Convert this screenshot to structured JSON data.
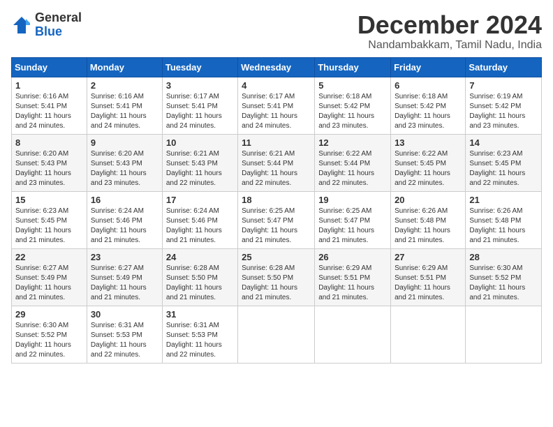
{
  "logo": {
    "general": "General",
    "blue": "Blue"
  },
  "title": "December 2024",
  "location": "Nandambakkam, Tamil Nadu, India",
  "headers": [
    "Sunday",
    "Monday",
    "Tuesday",
    "Wednesday",
    "Thursday",
    "Friday",
    "Saturday"
  ],
  "weeks": [
    [
      {
        "day": "1",
        "info": "Sunrise: 6:16 AM\nSunset: 5:41 PM\nDaylight: 11 hours\nand 24 minutes."
      },
      {
        "day": "2",
        "info": "Sunrise: 6:16 AM\nSunset: 5:41 PM\nDaylight: 11 hours\nand 24 minutes."
      },
      {
        "day": "3",
        "info": "Sunrise: 6:17 AM\nSunset: 5:41 PM\nDaylight: 11 hours\nand 24 minutes."
      },
      {
        "day": "4",
        "info": "Sunrise: 6:17 AM\nSunset: 5:41 PM\nDaylight: 11 hours\nand 24 minutes."
      },
      {
        "day": "5",
        "info": "Sunrise: 6:18 AM\nSunset: 5:42 PM\nDaylight: 11 hours\nand 23 minutes."
      },
      {
        "day": "6",
        "info": "Sunrise: 6:18 AM\nSunset: 5:42 PM\nDaylight: 11 hours\nand 23 minutes."
      },
      {
        "day": "7",
        "info": "Sunrise: 6:19 AM\nSunset: 5:42 PM\nDaylight: 11 hours\nand 23 minutes."
      }
    ],
    [
      {
        "day": "8",
        "info": "Sunrise: 6:20 AM\nSunset: 5:43 PM\nDaylight: 11 hours\nand 23 minutes."
      },
      {
        "day": "9",
        "info": "Sunrise: 6:20 AM\nSunset: 5:43 PM\nDaylight: 11 hours\nand 23 minutes."
      },
      {
        "day": "10",
        "info": "Sunrise: 6:21 AM\nSunset: 5:43 PM\nDaylight: 11 hours\nand 22 minutes."
      },
      {
        "day": "11",
        "info": "Sunrise: 6:21 AM\nSunset: 5:44 PM\nDaylight: 11 hours\nand 22 minutes."
      },
      {
        "day": "12",
        "info": "Sunrise: 6:22 AM\nSunset: 5:44 PM\nDaylight: 11 hours\nand 22 minutes."
      },
      {
        "day": "13",
        "info": "Sunrise: 6:22 AM\nSunset: 5:45 PM\nDaylight: 11 hours\nand 22 minutes."
      },
      {
        "day": "14",
        "info": "Sunrise: 6:23 AM\nSunset: 5:45 PM\nDaylight: 11 hours\nand 22 minutes."
      }
    ],
    [
      {
        "day": "15",
        "info": "Sunrise: 6:23 AM\nSunset: 5:45 PM\nDaylight: 11 hours\nand 21 minutes."
      },
      {
        "day": "16",
        "info": "Sunrise: 6:24 AM\nSunset: 5:46 PM\nDaylight: 11 hours\nand 21 minutes."
      },
      {
        "day": "17",
        "info": "Sunrise: 6:24 AM\nSunset: 5:46 PM\nDaylight: 11 hours\nand 21 minutes."
      },
      {
        "day": "18",
        "info": "Sunrise: 6:25 AM\nSunset: 5:47 PM\nDaylight: 11 hours\nand 21 minutes."
      },
      {
        "day": "19",
        "info": "Sunrise: 6:25 AM\nSunset: 5:47 PM\nDaylight: 11 hours\nand 21 minutes."
      },
      {
        "day": "20",
        "info": "Sunrise: 6:26 AM\nSunset: 5:48 PM\nDaylight: 11 hours\nand 21 minutes."
      },
      {
        "day": "21",
        "info": "Sunrise: 6:26 AM\nSunset: 5:48 PM\nDaylight: 11 hours\nand 21 minutes."
      }
    ],
    [
      {
        "day": "22",
        "info": "Sunrise: 6:27 AM\nSunset: 5:49 PM\nDaylight: 11 hours\nand 21 minutes."
      },
      {
        "day": "23",
        "info": "Sunrise: 6:27 AM\nSunset: 5:49 PM\nDaylight: 11 hours\nand 21 minutes."
      },
      {
        "day": "24",
        "info": "Sunrise: 6:28 AM\nSunset: 5:50 PM\nDaylight: 11 hours\nand 21 minutes."
      },
      {
        "day": "25",
        "info": "Sunrise: 6:28 AM\nSunset: 5:50 PM\nDaylight: 11 hours\nand 21 minutes."
      },
      {
        "day": "26",
        "info": "Sunrise: 6:29 AM\nSunset: 5:51 PM\nDaylight: 11 hours\nand 21 minutes."
      },
      {
        "day": "27",
        "info": "Sunrise: 6:29 AM\nSunset: 5:51 PM\nDaylight: 11 hours\nand 21 minutes."
      },
      {
        "day": "28",
        "info": "Sunrise: 6:30 AM\nSunset: 5:52 PM\nDaylight: 11 hours\nand 21 minutes."
      }
    ],
    [
      {
        "day": "29",
        "info": "Sunrise: 6:30 AM\nSunset: 5:52 PM\nDaylight: 11 hours\nand 22 minutes."
      },
      {
        "day": "30",
        "info": "Sunrise: 6:31 AM\nSunset: 5:53 PM\nDaylight: 11 hours\nand 22 minutes."
      },
      {
        "day": "31",
        "info": "Sunrise: 6:31 AM\nSunset: 5:53 PM\nDaylight: 11 hours\nand 22 minutes."
      },
      null,
      null,
      null,
      null
    ]
  ]
}
